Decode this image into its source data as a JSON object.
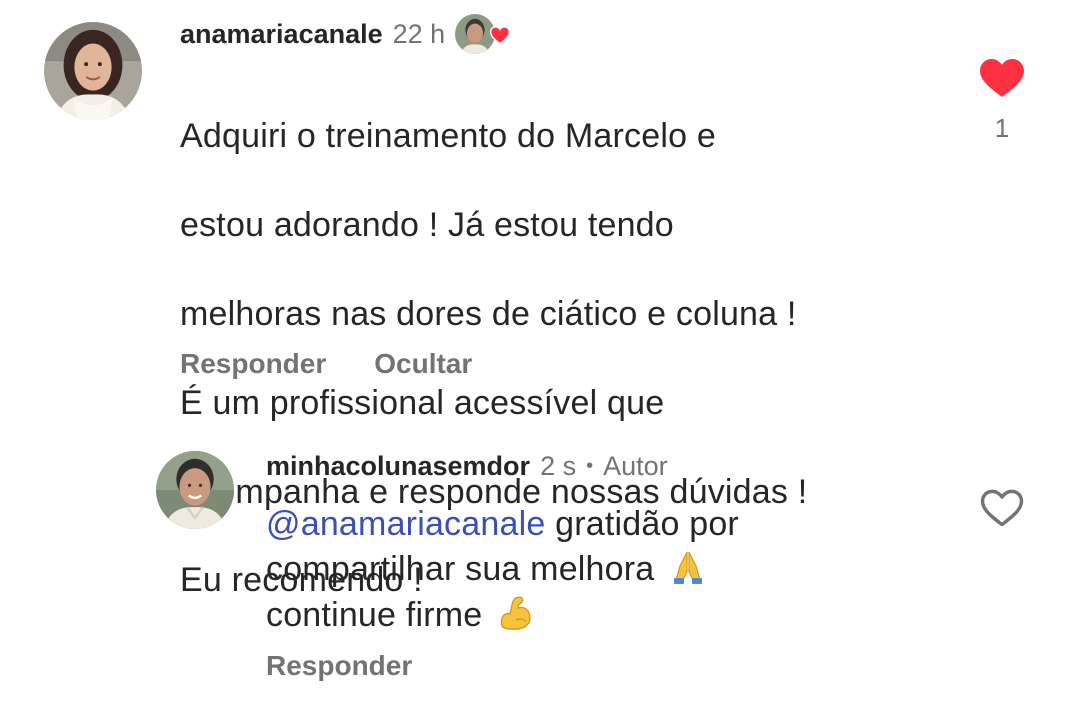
{
  "comment": {
    "username": "anamariacanale",
    "time": "22 h",
    "text_lines": [
      "Adquiri o treinamento do Marcelo e",
      "estou adorando ! Já estou tendo",
      "melhoras nas dores de ciático e coluna !",
      "É um profissional acessível que",
      "acompanha e responde nossas dúvidas !",
      "Eu recomendo !"
    ],
    "reply_label": "Responder",
    "hide_label": "Ocultar",
    "like_count": "1",
    "liked": true
  },
  "reply": {
    "username": "minhacolunasemdor",
    "time": "2 s",
    "separator": "•",
    "author_badge": "Autor",
    "mention": "@anamariacanale",
    "text_line1_rest": " gratidão por",
    "text_line2": "compartilhar sua melhora",
    "text_line3": "continue firme",
    "reply_label": "Responder",
    "liked": false
  },
  "icons": {
    "liked_heart": "heart-filled-icon",
    "like_heart": "heart-outline-icon",
    "author_liked_badge": "creator-liked-badge-icon",
    "pray_emoji": "folded-hands-emoji",
    "muscle_emoji": "flexed-biceps-emoji"
  },
  "colors": {
    "text": "#262626",
    "secondary": "#737373",
    "mention": "#3b4fb8",
    "heart_red": "#ff3040"
  }
}
